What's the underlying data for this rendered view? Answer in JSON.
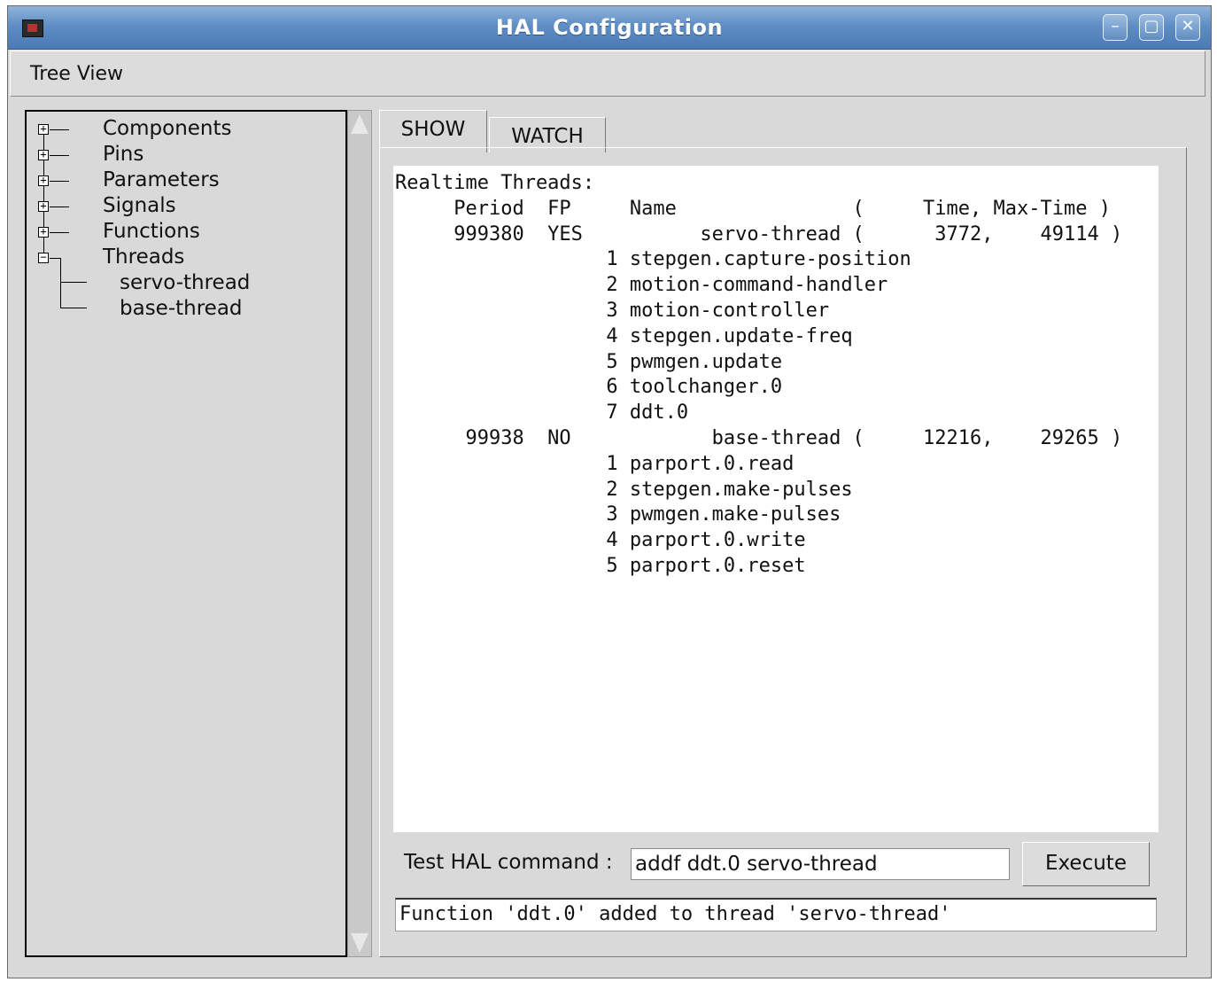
{
  "window": {
    "title": "HAL Configuration",
    "buttons": {
      "minimize_icon": "minimize-icon",
      "maximize_icon": "maximize-icon",
      "close_icon": "close-icon"
    }
  },
  "menu": {
    "items": [
      "Tree View"
    ]
  },
  "tree": {
    "items": [
      {
        "label": "Components",
        "expander": "plus"
      },
      {
        "label": "Pins",
        "expander": "plus"
      },
      {
        "label": "Parameters",
        "expander": "plus"
      },
      {
        "label": "Signals",
        "expander": "plus"
      },
      {
        "label": "Functions",
        "expander": "plus"
      },
      {
        "label": "Threads",
        "expander": "minus",
        "children": [
          "servo-thread",
          "base-thread"
        ]
      }
    ]
  },
  "tabs": [
    {
      "label": "SHOW",
      "active": true
    },
    {
      "label": "WATCH",
      "active": false
    }
  ],
  "show_output": {
    "lines": [
      "Realtime Threads:",
      "     Period  FP     Name               (     Time, Max-Time )",
      "     999380  YES          servo-thread (      3772,    49114 )",
      "                  1 stepgen.capture-position",
      "                  2 motion-command-handler",
      "                  3 motion-controller",
      "                  4 stepgen.update-freq",
      "                  5 pwmgen.update",
      "                  6 toolchanger.0",
      "                  7 ddt.0",
      "      99938  NO            base-thread (     12216,    29265 )",
      "                  1 parport.0.read",
      "                  2 stepgen.make-pulses",
      "                  3 pwmgen.make-pulses",
      "                  4 parport.0.write",
      "                  5 parport.0.reset"
    ]
  },
  "command": {
    "label": "Test HAL command :",
    "value": "addf ddt.0 servo-thread",
    "execute_label": "Execute",
    "result": "Function 'ddt.0' added to thread 'servo-thread'"
  },
  "colors": {
    "titlebar": "#5f8ec4",
    "window_bg": "#d9d9d9",
    "text_bg": "#ffffff"
  }
}
